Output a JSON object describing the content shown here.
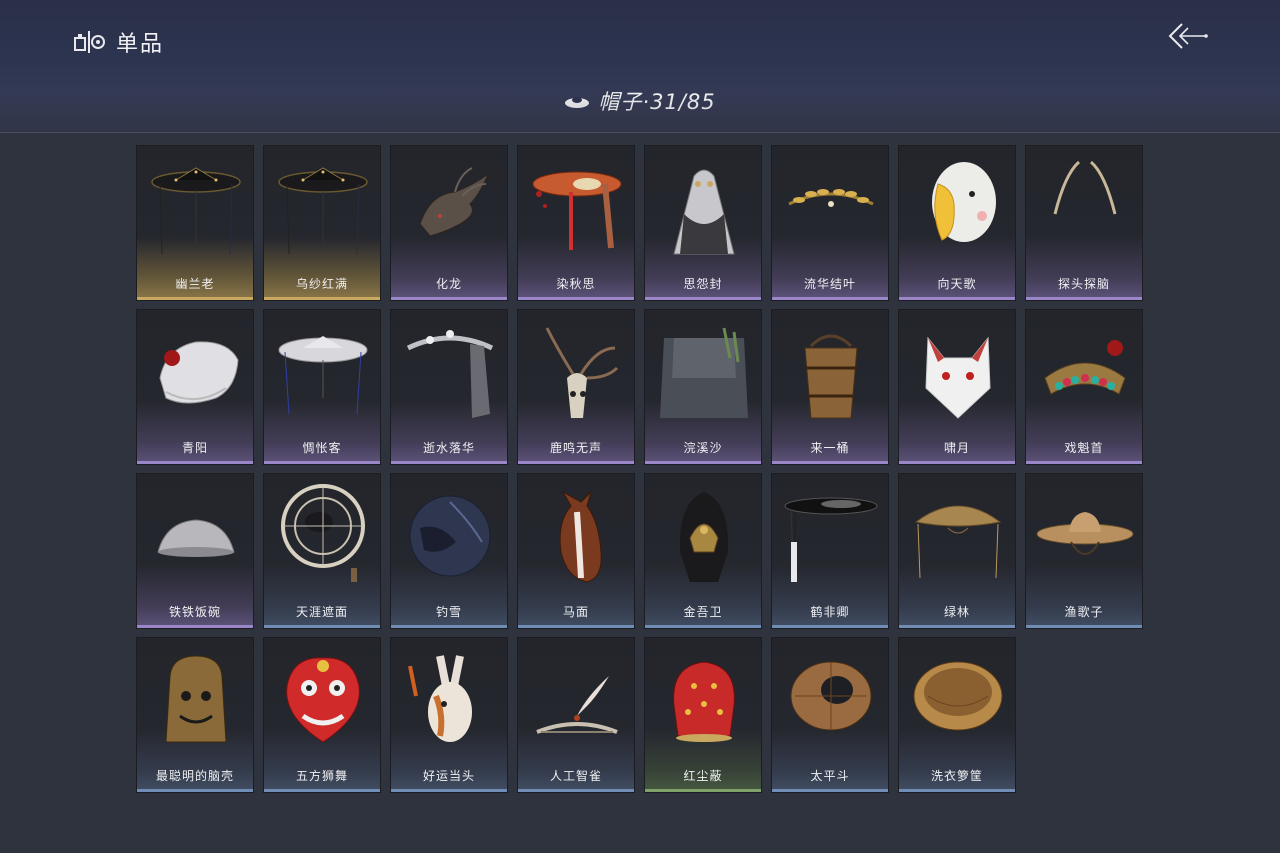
{
  "header": {
    "title": "单品",
    "category_label": "帽子·31/85"
  },
  "colors": {
    "gold": "#c9a860",
    "purple": "#9b87c8",
    "blue": "#6f8db5",
    "green": "#7fa16a"
  },
  "items": [
    {
      "name": "幽兰老",
      "rarity": "gold",
      "icon": "black-veiled-hat-icon"
    },
    {
      "name": "乌纱红满",
      "rarity": "gold",
      "icon": "black-veiled-hat-icon"
    },
    {
      "name": "化龙",
      "rarity": "purple",
      "icon": "dragon-head-icon"
    },
    {
      "name": "染秋思",
      "rarity": "purple",
      "icon": "red-tassel-hat-icon"
    },
    {
      "name": "思怨封",
      "rarity": "purple",
      "icon": "veil-hood-icon"
    },
    {
      "name": "流华结叶",
      "rarity": "purple",
      "icon": "gold-leaf-crown-icon"
    },
    {
      "name": "向天歌",
      "rarity": "purple",
      "icon": "goose-hood-icon"
    },
    {
      "name": "探头探脑",
      "rarity": "purple",
      "icon": "antenna-icon"
    },
    {
      "name": "青阳",
      "rarity": "purple",
      "icon": "white-cap-icon"
    },
    {
      "name": "惆怅客",
      "rarity": "purple",
      "icon": "white-veiled-hat-icon"
    },
    {
      "name": "逝水落华",
      "rarity": "purple",
      "icon": "flower-veil-icon"
    },
    {
      "name": "鹿鸣无声",
      "rarity": "purple",
      "icon": "deer-skull-icon"
    },
    {
      "name": "浣溪沙",
      "rarity": "purple",
      "icon": "grey-veil-icon"
    },
    {
      "name": "来一桶",
      "rarity": "purple",
      "icon": "wooden-bucket-icon"
    },
    {
      "name": "啸月",
      "rarity": "purple",
      "icon": "fox-mask-icon"
    },
    {
      "name": "戏魁首",
      "rarity": "purple",
      "icon": "opera-headdress-icon"
    },
    {
      "name": "铁铁饭碗",
      "rarity": "purple",
      "icon": "iron-bowl-icon"
    },
    {
      "name": "天涯遮面",
      "rarity": "blue",
      "icon": "lattice-hat-icon"
    },
    {
      "name": "钓雪",
      "rarity": "blue",
      "icon": "dark-straw-hat-icon"
    },
    {
      "name": "马面",
      "rarity": "blue",
      "icon": "horse-head-icon"
    },
    {
      "name": "金吾卫",
      "rarity": "blue",
      "icon": "guard-helmet-icon"
    },
    {
      "name": "鹤非卿",
      "rarity": "blue",
      "icon": "black-tassel-hat-icon"
    },
    {
      "name": "绿林",
      "rarity": "blue",
      "icon": "straw-veil-hat-icon"
    },
    {
      "name": "渔歌子",
      "rarity": "blue",
      "icon": "fisher-straw-hat-icon"
    },
    {
      "name": "最聪明的脑壳",
      "rarity": "blue",
      "icon": "bronze-bell-icon"
    },
    {
      "name": "五方狮舞",
      "rarity": "blue",
      "icon": "lion-dance-head-icon"
    },
    {
      "name": "好运当头",
      "rarity": "blue",
      "icon": "rabbit-mask-icon"
    },
    {
      "name": "人工智雀",
      "rarity": "blue",
      "icon": "bird-crest-icon"
    },
    {
      "name": "红尘蔽",
      "rarity": "green",
      "icon": "red-cloth-hood-icon"
    },
    {
      "name": "太平斗",
      "rarity": "blue",
      "icon": "woven-basket-hat-icon"
    },
    {
      "name": "洗衣箩筐",
      "rarity": "blue",
      "icon": "laundry-basket-icon"
    }
  ]
}
